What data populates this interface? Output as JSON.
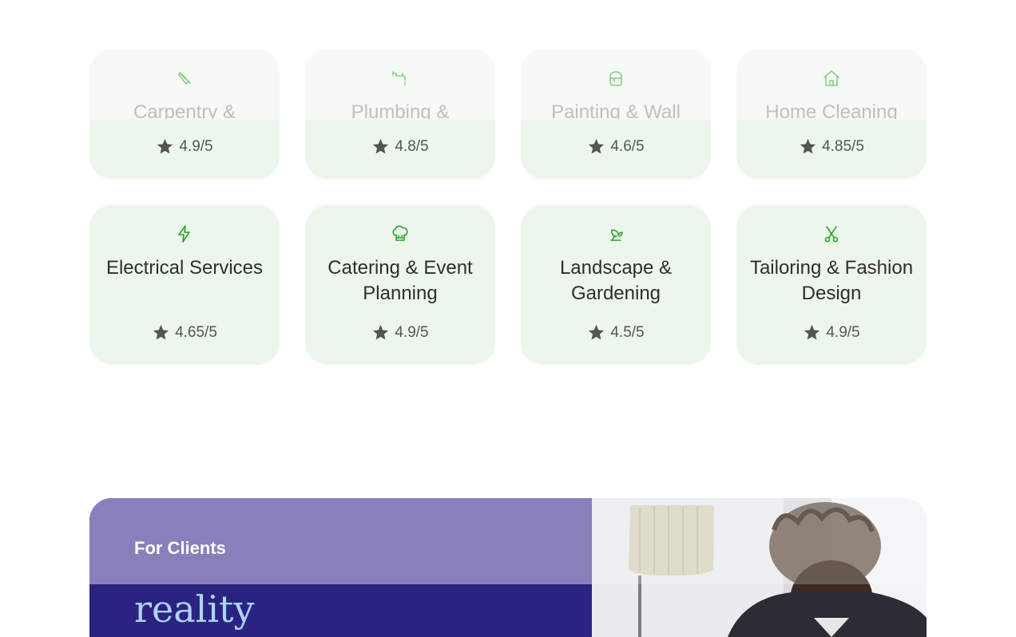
{
  "categories_row1": [
    {
      "title": "Carpentry &",
      "rating": "4.9/5",
      "icon": "saw-icon"
    },
    {
      "title": "Plumbing &",
      "rating": "4.8/5",
      "icon": "faucet-icon"
    },
    {
      "title": "Painting & Wall",
      "rating": "4.6/5",
      "icon": "paint-bucket-icon"
    },
    {
      "title": "Home Cleaning",
      "rating": "4.85/5",
      "icon": "house-icon"
    }
  ],
  "categories_row2": [
    {
      "title": "Electrical Services",
      "rating": "4.65/5",
      "icon": "lightning-icon"
    },
    {
      "title": "Catering & Event Planning",
      "rating": "4.9/5",
      "icon": "chef-hat-icon"
    },
    {
      "title": "Landscape & Gardening",
      "rating": "4.5/5",
      "icon": "plant-icon"
    },
    {
      "title": "Tailoring & Fashion Design",
      "rating": "4.9/5",
      "icon": "scissors-icon"
    }
  ],
  "banner": {
    "eyebrow": "For Clients",
    "headline_fragment": "reality"
  },
  "colors": {
    "card_bg": "#edf6ec",
    "icon_green": "#2da32a",
    "banner_dark": "#2b2382",
    "banner_light": "#8880ba",
    "headline": "#aed2f6"
  }
}
